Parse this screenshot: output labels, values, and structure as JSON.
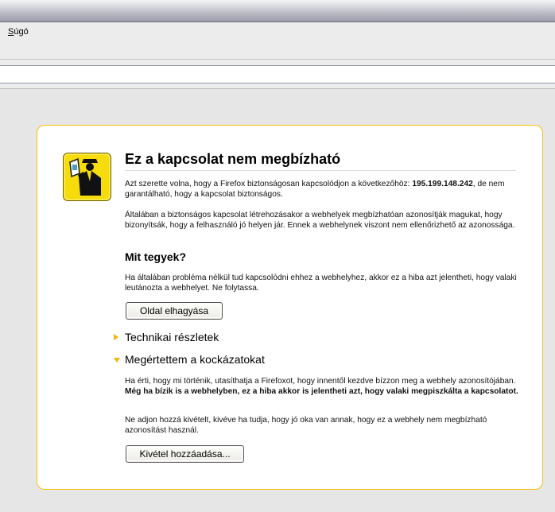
{
  "menu": {
    "help_prefix": "S",
    "help_rest": "úgó"
  },
  "urlbar": {
    "value": ""
  },
  "error": {
    "title": "Ez a kapcsolat nem megbízható",
    "intro_before": "Azt szerette volna, hogy a Firefox biztonságosan kapcsolódjon a következőhöz: ",
    "host": "195.199.148.242",
    "intro_after": ", de nem garantálható, hogy a kapcsolat biztonságos.",
    "explain": "Általában a biztonságos kapcsolat létrehozásakor a webhelyek megbízhatóan azonosítják magukat, hogy bizonyítsák, hogy a felhasználó jó helyen jár. Ennek a webhelynek viszont nem ellenőrizhető az azonossága.",
    "what_heading": "Mit tegyek?",
    "what_text": "Ha általában probléma nélkül tud kapcsolódni ehhez a webhelyhez, akkor ez a hiba azt jelentheti, hogy valaki leutánozta a webhelyet. Ne folytassa.",
    "leave_button": "Oldal elhagyása",
    "technical_label": "Technikai részletek",
    "risks_label": "Megértettem a kockázatokat",
    "risks_text_plain": "Ha érti, hogy mi történik, utasíthatja a Firefoxot, hogy innentől kezdve bízzon meg a webhely azonosítójában. ",
    "risks_text_bold": "Még ha bízik is a webhelyben, ez a hiba akkor is jelentheti azt, hogy valaki megpiszkálta a kapcsolatot.",
    "risks_text_2": "Ne adjon hozzá kivételt, kivéve ha tudja, hogy jó oka van annak, hogy ez a webhely nem megbízható azonosítást használ.",
    "exception_button": "Kivétel hozzáadása..."
  },
  "colors": {
    "accent": "#ffbd09",
    "icon_yellow": "#f5dc0a"
  },
  "icons": {
    "cert": "police-officer-icon"
  }
}
